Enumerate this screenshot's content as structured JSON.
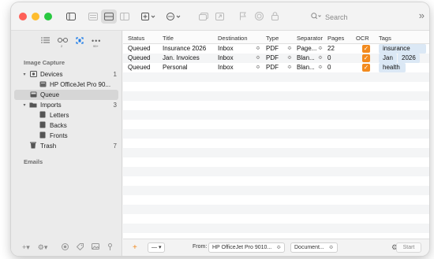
{
  "toolbar": {
    "search_placeholder": "Search",
    "icons": [
      "sidebar-toggle-icon",
      "view-list-icon",
      "view-columns-icon",
      "view-split-icon",
      "add-menu-icon",
      "more-menu-icon",
      "duplicate-icon",
      "share-icon",
      "flag-icon",
      "stop-icon",
      "lock-icon",
      "search-icon",
      "overflow-icon"
    ]
  },
  "sidebar": {
    "tabs": [
      {
        "icon": "list-icon",
        "sub": ""
      },
      {
        "icon": "link-icon",
        "sub": "2"
      },
      {
        "icon": "scan-icon",
        "sub": ""
      },
      {
        "icon": "dots-icon",
        "sub": "99+"
      }
    ],
    "section_image_capture": "Image Capture",
    "devices_label": "Devices",
    "devices_count": "1",
    "device_name": "HP OfficeJet Pro 90...",
    "queue_label": "Queue",
    "imports_label": "Imports",
    "imports_count": "3",
    "letters_label": "Letters",
    "backs_label": "Backs",
    "fronts_label": "Fronts",
    "trash_label": "Trash",
    "trash_count": "7",
    "section_emails": "Emails"
  },
  "table": {
    "headers": {
      "status": "Status",
      "title": "Title",
      "destination": "Destination",
      "type": "Type",
      "separator": "Separator",
      "pages": "Pages",
      "ocr": "OCR",
      "tags": "Tags"
    },
    "rows": [
      {
        "status": "Queued",
        "title": "Insurance 2026",
        "destination": "Inbox",
        "type": "PDF",
        "separator": "Page...",
        "pages": "22",
        "ocr": true,
        "tags": [
          "insurance"
        ]
      },
      {
        "status": "Queued",
        "title": "Jan. Invoices",
        "destination": "Inbox",
        "type": "PDF",
        "separator": "Blan...",
        "pages": "0",
        "ocr": true,
        "tags": [
          "Jan",
          "2026"
        ]
      },
      {
        "status": "Queued",
        "title": "Personal",
        "destination": "Inbox",
        "type": "PDF",
        "separator": "Blan...",
        "pages": "0",
        "ocr": true,
        "tags": [
          "health"
        ]
      }
    ]
  },
  "bottombar": {
    "plus": "+",
    "action_menu": "— ▾",
    "from_label": "From:",
    "from_value": "HP OfficeJet Pro 9010...",
    "format_value": "Document...",
    "start_label": "Start"
  },
  "colors": {
    "accent_orange": "#f28a1e",
    "tag_bg": "#dbe8f5",
    "selected_blue": "#1e7ce8"
  }
}
